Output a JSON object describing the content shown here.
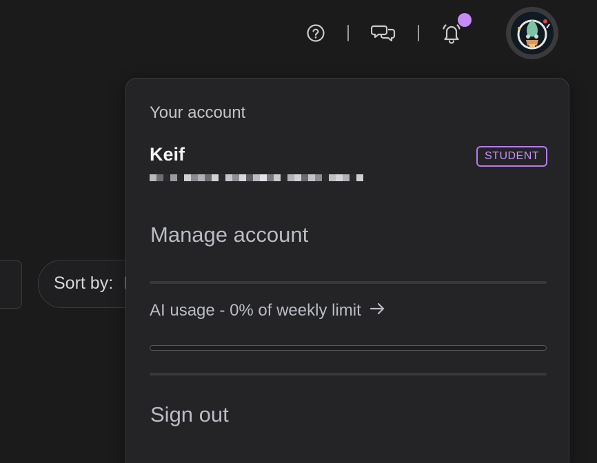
{
  "topbar": {
    "icons": [
      "help-circle-icon",
      "chat-bubbles-icon",
      "bell-icon"
    ],
    "notification_dot_color": "#c58cf5"
  },
  "background": {
    "sort_label": "Sort by:",
    "sort_value_partial": "I"
  },
  "account_menu": {
    "heading": "Your account",
    "user_name": "Keif",
    "role_badge": "STUDENT",
    "email_obscured": true,
    "manage_account_label": "Manage account",
    "ai_usage_label": "AI usage - 0% of weekly limit",
    "ai_usage_percent": 0,
    "sign_out_label": "Sign out"
  },
  "colors": {
    "accent": "#b57bf0",
    "background": "#1b1b1c",
    "menu_background": "#242426"
  }
}
